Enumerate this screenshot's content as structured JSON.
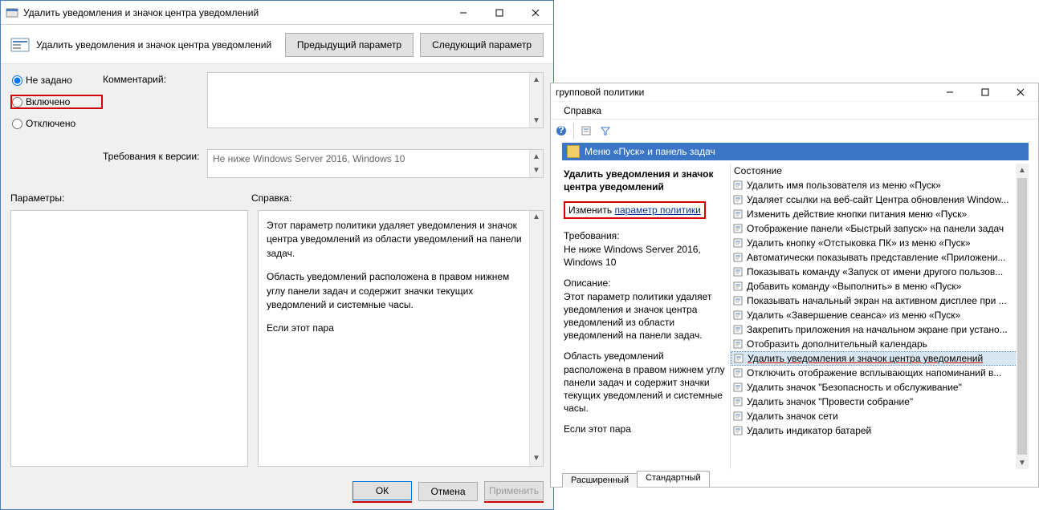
{
  "dlg": {
    "title": "Удалить уведомления и значок центра уведомлений",
    "header_title": "Удалить уведомления и значок центра уведомлений",
    "prev_btn": "Предыдущий параметр",
    "next_btn": "Следующий параметр",
    "radio_notconf": "Не задано",
    "radio_enabled": "Включено",
    "radio_disabled": "Отключено",
    "comment_label": "Комментарий:",
    "req_label": "Требования к версии:",
    "req_text": "Не ниже Windows Server 2016, Windows 10",
    "params_label": "Параметры:",
    "help_label": "Справка:",
    "help_p1": "Этот параметр политики удаляет уведомления и значок центра уведомлений из области уведомлений на панели задач.",
    "help_p2": "Область уведомлений расположена в правом нижнем углу панели задач и содержит значки текущих уведомлений и системные часы.",
    "help_p3": "Если этот пара",
    "ok": "ОК",
    "cancel": "Отмена",
    "apply": "Применить"
  },
  "mmc": {
    "title": "групповой политики",
    "menu_help": "Справка",
    "node": "Меню «Пуск» и панель задач",
    "left_title": "Удалить уведомления и значок центра уведомлений",
    "change_prefix": "Изменить ",
    "change_link": "параметр политики",
    "req_h": "Требования:",
    "req_t": "Не ниже Windows Server 2016, Windows 10",
    "desc_h": "Описание:",
    "desc_t1": "Этот параметр политики удаляет уведомления и значок центра уведомлений из области уведомлений на панели задач.",
    "desc_t2": "Область уведомлений расположена в правом нижнем углу панели задач и содержит значки текущих уведомлений и системные часы.",
    "desc_t3": "Если этот пара",
    "col_state": "Состояние",
    "tabs": {
      "ext": "Расширенный",
      "std": "Стандартный"
    },
    "items": [
      "Удалить имя пользователя из меню «Пуск»",
      "Удаляет ссылки на веб-сайт Центра обновления Window...",
      "Изменить действие кнопки питания меню «Пуск»",
      "Отображение панели «Быстрый запуск» на панели задач",
      "Удалить кнопку «Отстыковка ПК» из меню «Пуск»",
      "Автоматически показывать представление «Приложени...",
      "Показывать команду «Запуск от имени другого пользов...",
      "Добавить команду «Выполнить» в меню «Пуск»",
      "Показывать начальный экран на активном дисплее при ...",
      "Удалить «Завершение сеанса» из меню «Пуск»",
      "Закрепить приложения на начальном экране при устано...",
      "Отобразить дополнительный календарь",
      "Удалить уведомления и значок центра уведомлений",
      "Отключить отображение всплывающих напоминаний в...",
      "Удалить значок \"Безопасность и обслуживание\"",
      "Удалить значок \"Провести собрание\"",
      "Удалить значок сети",
      "Удалить индикатор батарей"
    ],
    "selected_index": 12
  }
}
